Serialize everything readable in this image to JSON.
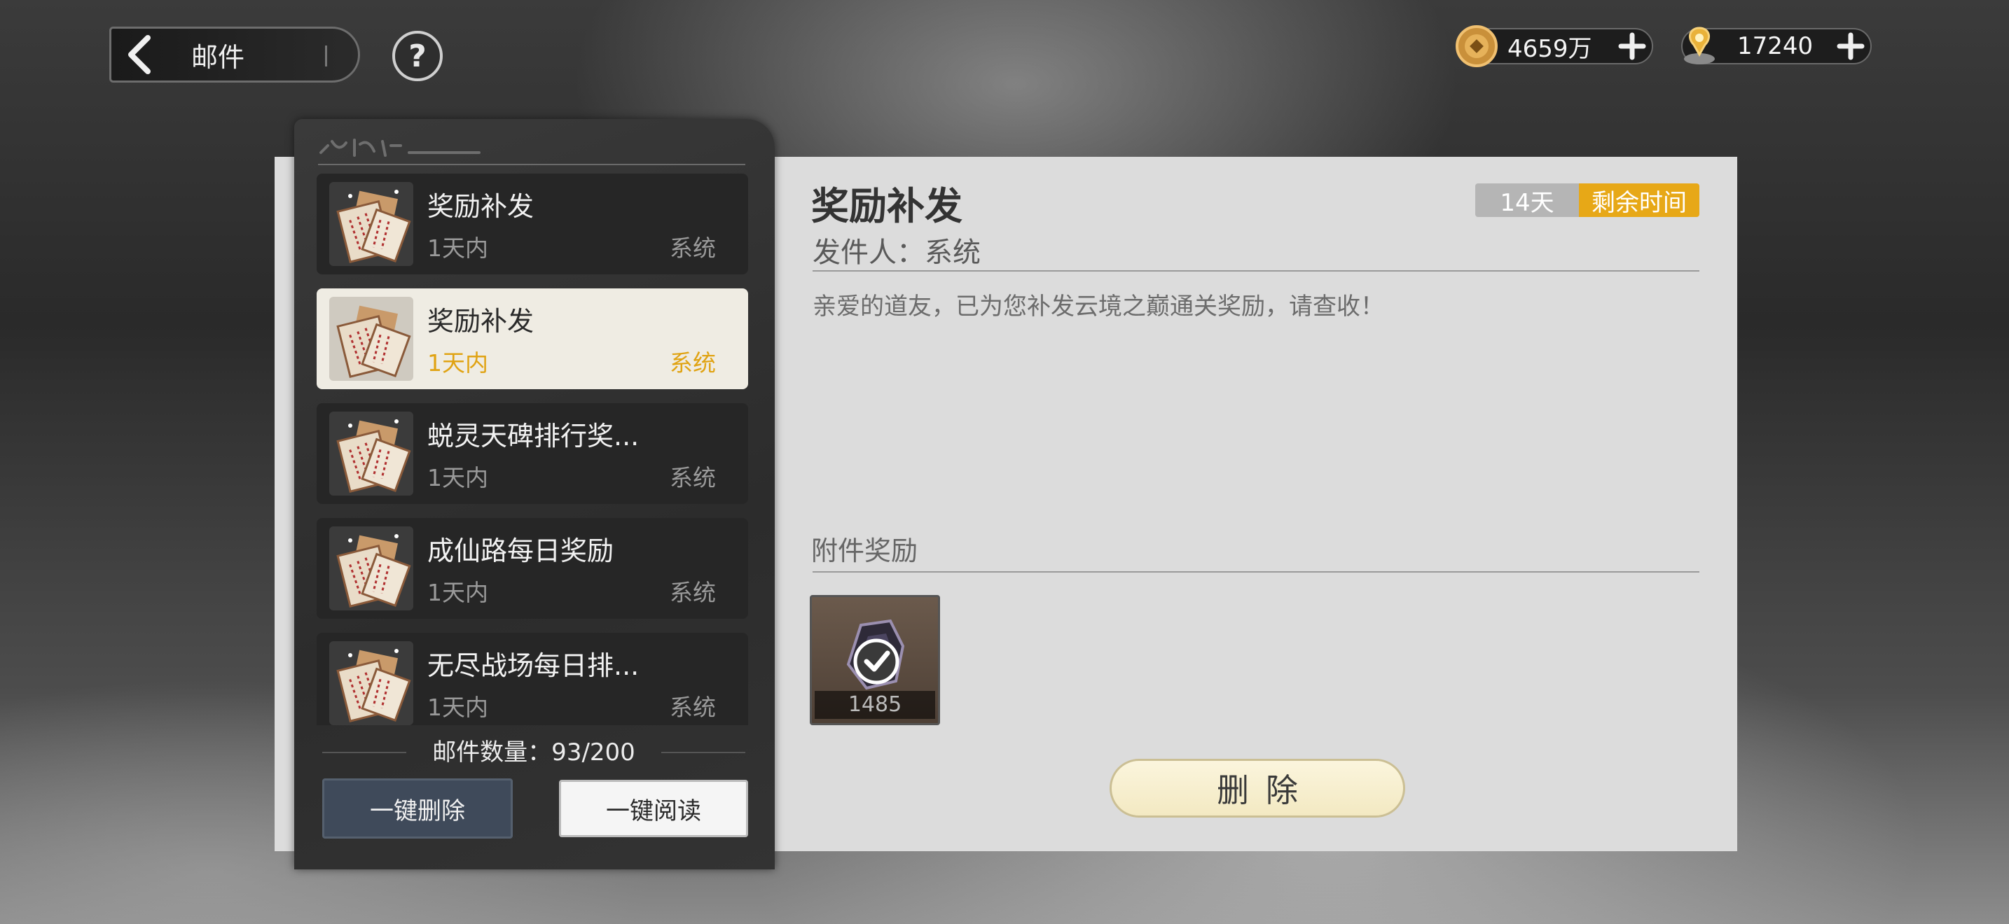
{
  "header": {
    "title": "邮件",
    "help": "?"
  },
  "currencies": [
    {
      "icon": "coin-icon",
      "value": "4659万"
    },
    {
      "icon": "spirit-stone-icon",
      "value": "17240"
    }
  ],
  "mail_list": {
    "items": [
      {
        "title": "奖励补发",
        "time": "1天内",
        "sender": "系统",
        "selected": false
      },
      {
        "title": "奖励补发",
        "time": "1天内",
        "sender": "系统",
        "selected": true
      },
      {
        "title": "蜕灵天碑排行奖...",
        "time": "1天内",
        "sender": "系统",
        "selected": false
      },
      {
        "title": "成仙路每日奖励",
        "time": "1天内",
        "sender": "系统",
        "selected": false
      },
      {
        "title": "无尽战场每日排...",
        "time": "1天内",
        "sender": "系统",
        "selected": false
      }
    ],
    "count_text": "邮件数量：93/200",
    "delete_all_label": "一键删除",
    "read_all_label": "一键阅读"
  },
  "detail": {
    "title": "奖励补发",
    "sender": "发件人：系统",
    "expire_days": "14天",
    "expire_label": "剩余时间",
    "body": "亲爱的道友，已为您补发云境之巅通关奖励，请查收！",
    "attachments_title": "附件奖励",
    "attachments": [
      {
        "icon": "reward-item-icon",
        "quantity": "1485",
        "claimed": true
      }
    ],
    "delete_label": "删除"
  }
}
